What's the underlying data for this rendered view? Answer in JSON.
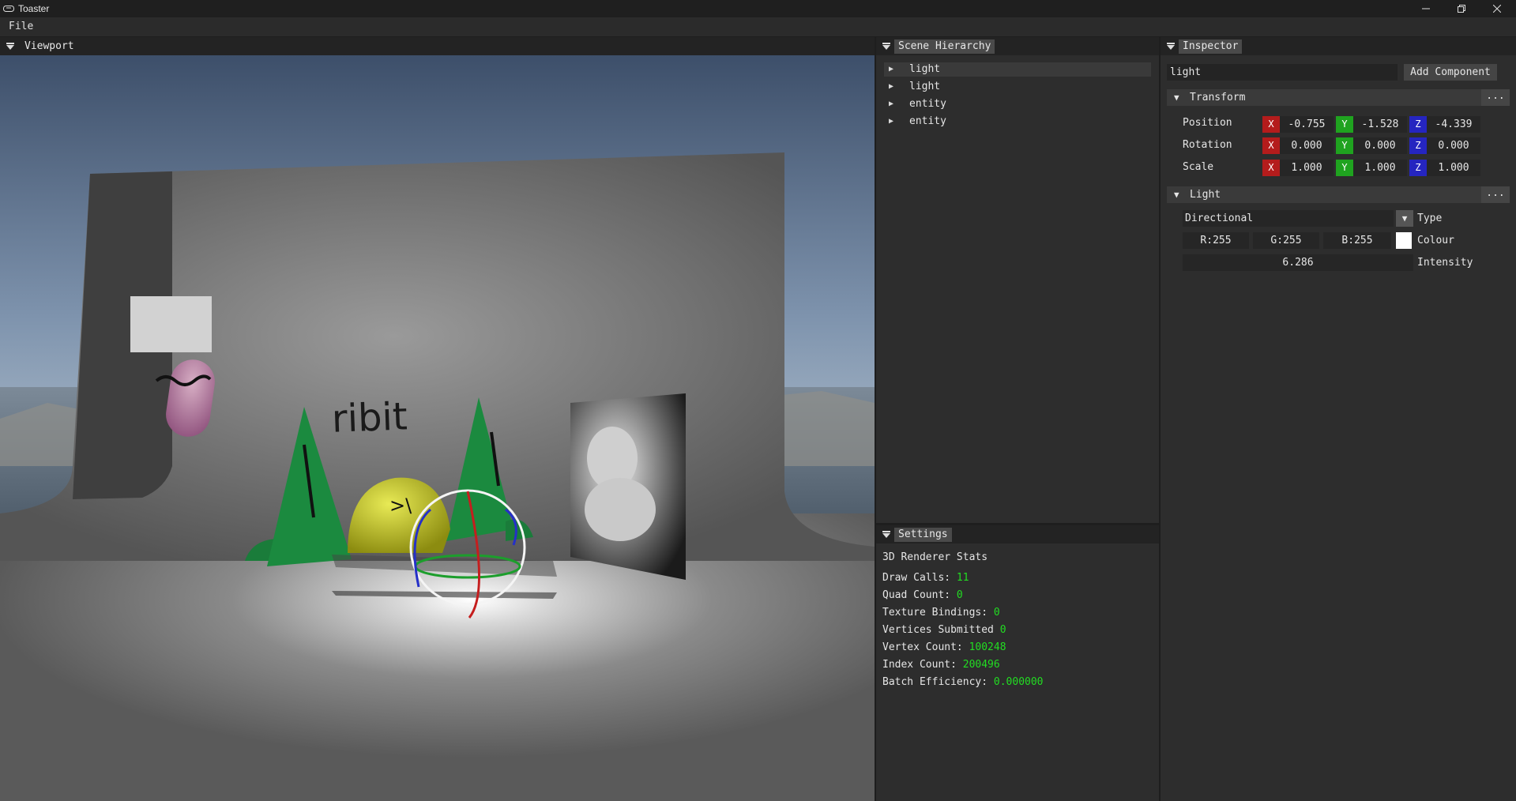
{
  "window": {
    "title": "Toaster",
    "minimize_icon": "minimize-icon",
    "maximize_icon": "restore-icon",
    "close_icon": "close-icon"
  },
  "menu": {
    "file": "File"
  },
  "viewport": {
    "tab": "Viewport",
    "scene_text": "ribit",
    "face_text": ">\\"
  },
  "hierarchy": {
    "tab": "Scene Hierarchy",
    "items": [
      {
        "label": "light",
        "selected": true
      },
      {
        "label": "light",
        "selected": false
      },
      {
        "label": "entity",
        "selected": false
      },
      {
        "label": "entity",
        "selected": false
      }
    ]
  },
  "settings": {
    "tab": "Settings",
    "title": "3D Renderer Stats",
    "stats": [
      {
        "label": "Draw Calls:",
        "value": "11"
      },
      {
        "label": "Quad Count:",
        "value": "0"
      },
      {
        "label": "Texture Bindings:",
        "value": "0"
      },
      {
        "label": "Vertices Submitted",
        "value": "0"
      },
      {
        "label": "Vertex Count:",
        "value": "100248"
      },
      {
        "label": "Index Count:",
        "value": "200496"
      },
      {
        "label": "Batch Efficiency:",
        "value": "0.000000"
      }
    ],
    "value_color": "#22dd22"
  },
  "inspector": {
    "tab": "Inspector",
    "name": "light",
    "add_component": "Add Component",
    "transform": {
      "title": "Transform",
      "menu": "...",
      "rows": [
        {
          "label": "Position",
          "x": "-0.755",
          "y": "-1.528",
          "z": "-4.339"
        },
        {
          "label": "Rotation",
          "x": "0.000",
          "y": "0.000",
          "z": "0.000"
        },
        {
          "label": "Scale",
          "x": "1.000",
          "y": "1.000",
          "z": "1.000"
        }
      ],
      "axis_labels": {
        "x": "X",
        "y": "Y",
        "z": "Z"
      }
    },
    "light": {
      "title": "Light",
      "menu": "...",
      "type_value": "Directional",
      "type_label": "Type",
      "r": "R:255",
      "g": "G:255",
      "b": "B:255",
      "colour_label": "Colour",
      "colour_swatch": "#ffffff",
      "intensity": "6.286",
      "intensity_label": "Intensity"
    }
  }
}
